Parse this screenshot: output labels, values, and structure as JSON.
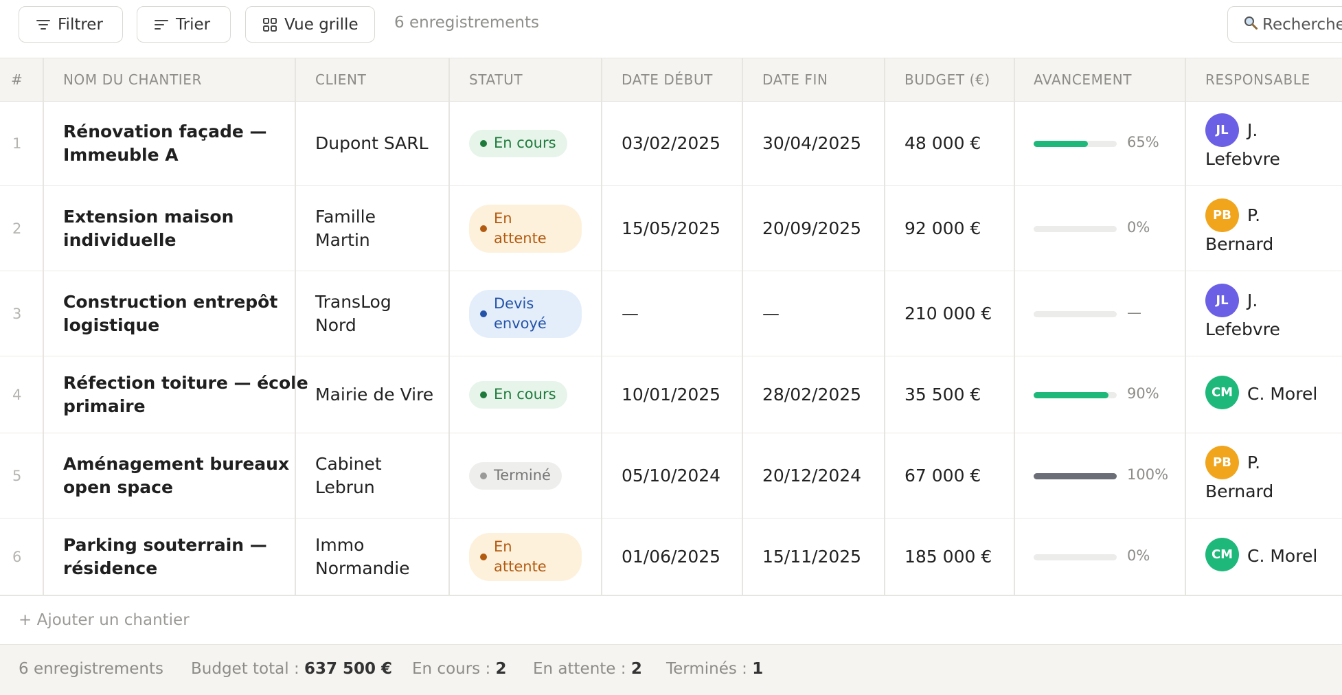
{
  "toolbar": {
    "filter_label": "Filtrer",
    "sort_label": "Trier",
    "grid_view_label": "Vue grille",
    "record_count": "6 enregistrements",
    "search_placeholder": "Rechercher"
  },
  "table": {
    "columns": [
      "#",
      "NOM DU CHANTIER",
      "CLIENT",
      "STATUT",
      "DATE DÉBUT",
      "DATE FIN",
      "BUDGET (€)",
      "AVANCEMENT",
      "RESPONSABLE"
    ],
    "rows": [
      {
        "num": "1",
        "name_l1": "Rénovation façade —",
        "name_l2": "Immeuble A",
        "client_l1": "Dupont SARL",
        "client_l2": "",
        "status_l1": "En cours",
        "status_l2": "",
        "status_kind": "green",
        "start": "03/02/2025",
        "end": "30/04/2025",
        "budget": "48 000 €",
        "progress": 0.65,
        "progress_label": "65%",
        "progress_color": "#1eb97a",
        "avatar": "JL",
        "avatar_color": "#6b5fe6",
        "resp_l1": "J.",
        "resp_l2": "Lefebvre"
      },
      {
        "num": "2",
        "name_l1": "Extension maison",
        "name_l2": "individuelle",
        "client_l1": "Famille",
        "client_l2": "Martin",
        "status_l1": "En",
        "status_l2": "attente",
        "status_kind": "orange",
        "start": "15/05/2025",
        "end": "20/09/2025",
        "budget": "92 000 €",
        "progress": 0,
        "progress_label": "0%",
        "progress_color": "#1eb97a",
        "avatar": "PB",
        "avatar_color": "#f0a51c",
        "resp_l1": "P.",
        "resp_l2": "Bernard"
      },
      {
        "num": "3",
        "name_l1": "Construction entrepôt",
        "name_l2": "logistique",
        "client_l1": "TransLog",
        "client_l2": "Nord",
        "status_l1": "Devis",
        "status_l2": "envoyé",
        "status_kind": "blue",
        "start": "—",
        "end": "—",
        "budget": "210 000 €",
        "progress": 0,
        "progress_label": "—",
        "progress_color": "#1eb97a",
        "avatar": "JL",
        "avatar_color": "#6b5fe6",
        "resp_l1": "J.",
        "resp_l2": "Lefebvre"
      },
      {
        "num": "4",
        "name_l1": "Réfection toiture — école",
        "name_l2": "primaire",
        "client_l1": "Mairie de Vire",
        "client_l2": "",
        "status_l1": "En cours",
        "status_l2": "",
        "status_kind": "green",
        "start": "10/01/2025",
        "end": "28/02/2025",
        "budget": "35 500 €",
        "progress": 0.9,
        "progress_label": "90%",
        "progress_color": "#1eb97a",
        "avatar": "CM",
        "avatar_color": "#1eb97a",
        "resp_l1": "C. Morel",
        "resp_l2": ""
      },
      {
        "num": "5",
        "name_l1": "Aménagement bureaux",
        "name_l2": "open space",
        "client_l1": "Cabinet",
        "client_l2": "Lebrun",
        "status_l1": "Terminé",
        "status_l2": "",
        "status_kind": "gray",
        "start": "05/10/2024",
        "end": "20/12/2024",
        "budget": "67 000 €",
        "progress": 1.0,
        "progress_label": "100%",
        "progress_color": "#6b6e76",
        "avatar": "PB",
        "avatar_color": "#f0a51c",
        "resp_l1": "P.",
        "resp_l2": "Bernard"
      },
      {
        "num": "6",
        "name_l1": "Parking souterrain —",
        "name_l2": "résidence",
        "client_l1": "Immo",
        "client_l2": "Normandie",
        "status_l1": "En",
        "status_l2": "attente",
        "status_kind": "orange",
        "start": "01/06/2025",
        "end": "15/11/2025",
        "budget": "185 000 €",
        "progress": 0,
        "progress_label": "0%",
        "progress_color": "#1eb97a",
        "avatar": "CM",
        "avatar_color": "#1eb97a",
        "resp_l1": "C. Morel",
        "resp_l2": ""
      }
    ]
  },
  "add_row_label": "+ Ajouter un chantier",
  "footer": {
    "count": "6 enregistrements",
    "budget_label": "Budget total :",
    "budget_value": "637 500 €",
    "in_progress_label": "En cours :",
    "in_progress_value": "2",
    "pending_label": "En attente :",
    "pending_value": "2",
    "done_label": "Terminés :",
    "done_value": "1"
  }
}
